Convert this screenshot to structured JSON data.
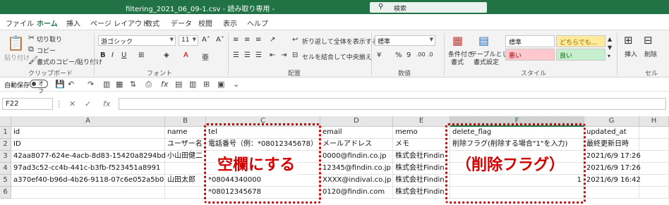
{
  "window": {
    "title": "filtering_2021_06_09-1.csv  -  読み取り専用  -",
    "search_placeholder": "検索"
  },
  "tabs": [
    "ファイル",
    "ホーム",
    "挿入",
    "ページ レイアウト",
    "数式",
    "データ",
    "校閲",
    "表示",
    "ヘルプ"
  ],
  "ribbon": {
    "clipboard": {
      "paste": "貼り付け",
      "cut": "切り取り",
      "copy": "コピー",
      "format_painter": "書式のコピー/貼り付け",
      "label": "クリップボード"
    },
    "font": {
      "name": "游ゴシック",
      "size": "11",
      "label": "フォント"
    },
    "alignment": {
      "wrap": "折り返して全体を表示する",
      "merge": "セルを結合して中央揃え",
      "label": "配置"
    },
    "number": {
      "format": "標準",
      "label": "数値"
    },
    "styles": {
      "conditional": [
        "条件付き",
        "書式"
      ],
      "table": [
        "テーブルとして",
        "書式設定"
      ],
      "standard": "標準",
      "neutral": "どちらでも...",
      "bad": "悪い",
      "good": "良い",
      "label": "スタイル"
    },
    "cells": {
      "insert": "挿入",
      "delete": "削除",
      "label": "セル"
    }
  },
  "qat": {
    "autosave": "自動保存",
    "toggle": "オフ"
  },
  "formula_bar": {
    "name_box": "F22",
    "formula": ""
  },
  "columns": [
    "A",
    "B",
    "C",
    "D",
    "E",
    "F",
    "G",
    "H"
  ],
  "selected_column": "F",
  "rows": [
    {
      "num": "1",
      "cells": [
        "id",
        "name",
        "tel",
        "email",
        "memo",
        "delete_flag",
        "updated_at",
        ""
      ]
    },
    {
      "num": "2",
      "cells": [
        "ID",
        "ユーザー名",
        "電話番号（例：*08012345678）",
        "メールアドレス",
        "メモ",
        "削除フラグ(削除する場合\"1\"を入力)",
        "最終更新日時",
        ""
      ]
    },
    {
      "num": "3",
      "cells": [
        "42aa8077-624e-4acb-8d83-15420a8294bd",
        "小山田健二",
        "",
        "0000@findin.co.jp",
        "株式会社Findin",
        "",
        "2021/6/9 17:26",
        ""
      ]
    },
    {
      "num": "4",
      "cells": [
        "97ad3c52-cc4b-441c-b3fb-f523451a8991",
        "",
        "",
        "12345@findin.co.jp",
        "株式会社Findin",
        "",
        "2021/6/9 17:26",
        ""
      ]
    },
    {
      "num": "5",
      "cells": [
        "a370ef40-b96d-4b26-9118-07c6e052a5b0",
        "山田太郎",
        "*08044340000",
        "XXXX@indival.co.jp",
        "株式会社Findin",
        "1",
        "2021/6/9 16:42",
        ""
      ]
    },
    {
      "num": "6",
      "cells": [
        "",
        "",
        "*08012345678",
        "0120@findin.com",
        "株式会社Findin",
        "",
        "",
        ""
      ]
    }
  ],
  "annotations": {
    "left_callout": "空欄にする",
    "right_callout": "（削除フラグ）"
  },
  "colors": {
    "excel_green": "#217346",
    "annotation_red": "#d40000"
  }
}
